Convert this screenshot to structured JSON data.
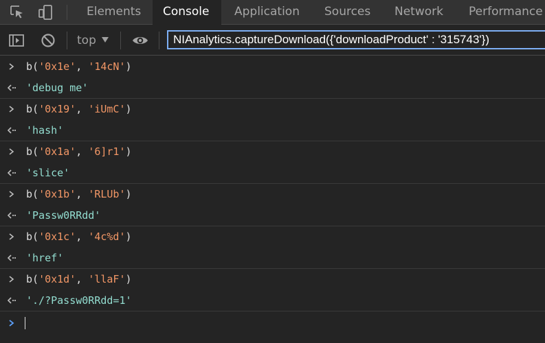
{
  "tabs": [
    {
      "label": "Elements",
      "active": false
    },
    {
      "label": "Console",
      "active": true
    },
    {
      "label": "Application",
      "active": false
    },
    {
      "label": "Sources",
      "active": false
    },
    {
      "label": "Network",
      "active": false
    },
    {
      "label": "Performance",
      "active": false
    }
  ],
  "toolbar": {
    "context": "top",
    "filter_value": "NIAnalytics.captureDownload({'downloadProduct' : '315743'})"
  },
  "console": {
    "entries": [
      {
        "call": "b(",
        "arg1": "'0x1e'",
        "comma": ", ",
        "arg2": "'14cN'",
        "close": ")",
        "result": "'debug me'"
      },
      {
        "call": "b(",
        "arg1": "'0x19'",
        "comma": ", ",
        "arg2": "'iUmC'",
        "close": ")",
        "result": "'hash'"
      },
      {
        "call": "b(",
        "arg1": "'0x1a'",
        "comma": ", ",
        "arg2": "'6]r1'",
        "close": ")",
        "result": "'slice'"
      },
      {
        "call": "b(",
        "arg1": "'0x1b'",
        "comma": ", ",
        "arg2": "'RLUb'",
        "close": ")",
        "result": "'Passw0RRdd'"
      },
      {
        "call": "b(",
        "arg1": "'0x1c'",
        "comma": ", ",
        "arg2": "'4c%d'",
        "close": ")",
        "result": "'href'"
      },
      {
        "call": "b(",
        "arg1": "'0x1d'",
        "comma": ", ",
        "arg2": "'llaF'",
        "close": ")",
        "result": "'./?Passw0RRdd=1'"
      }
    ]
  },
  "colors": {
    "background": "#242424",
    "tabbar": "#333333",
    "string": "#f29766",
    "result_string": "#93ddd0",
    "filter_border": "#7eb0f5",
    "prompt_blue": "#5b9df5"
  }
}
